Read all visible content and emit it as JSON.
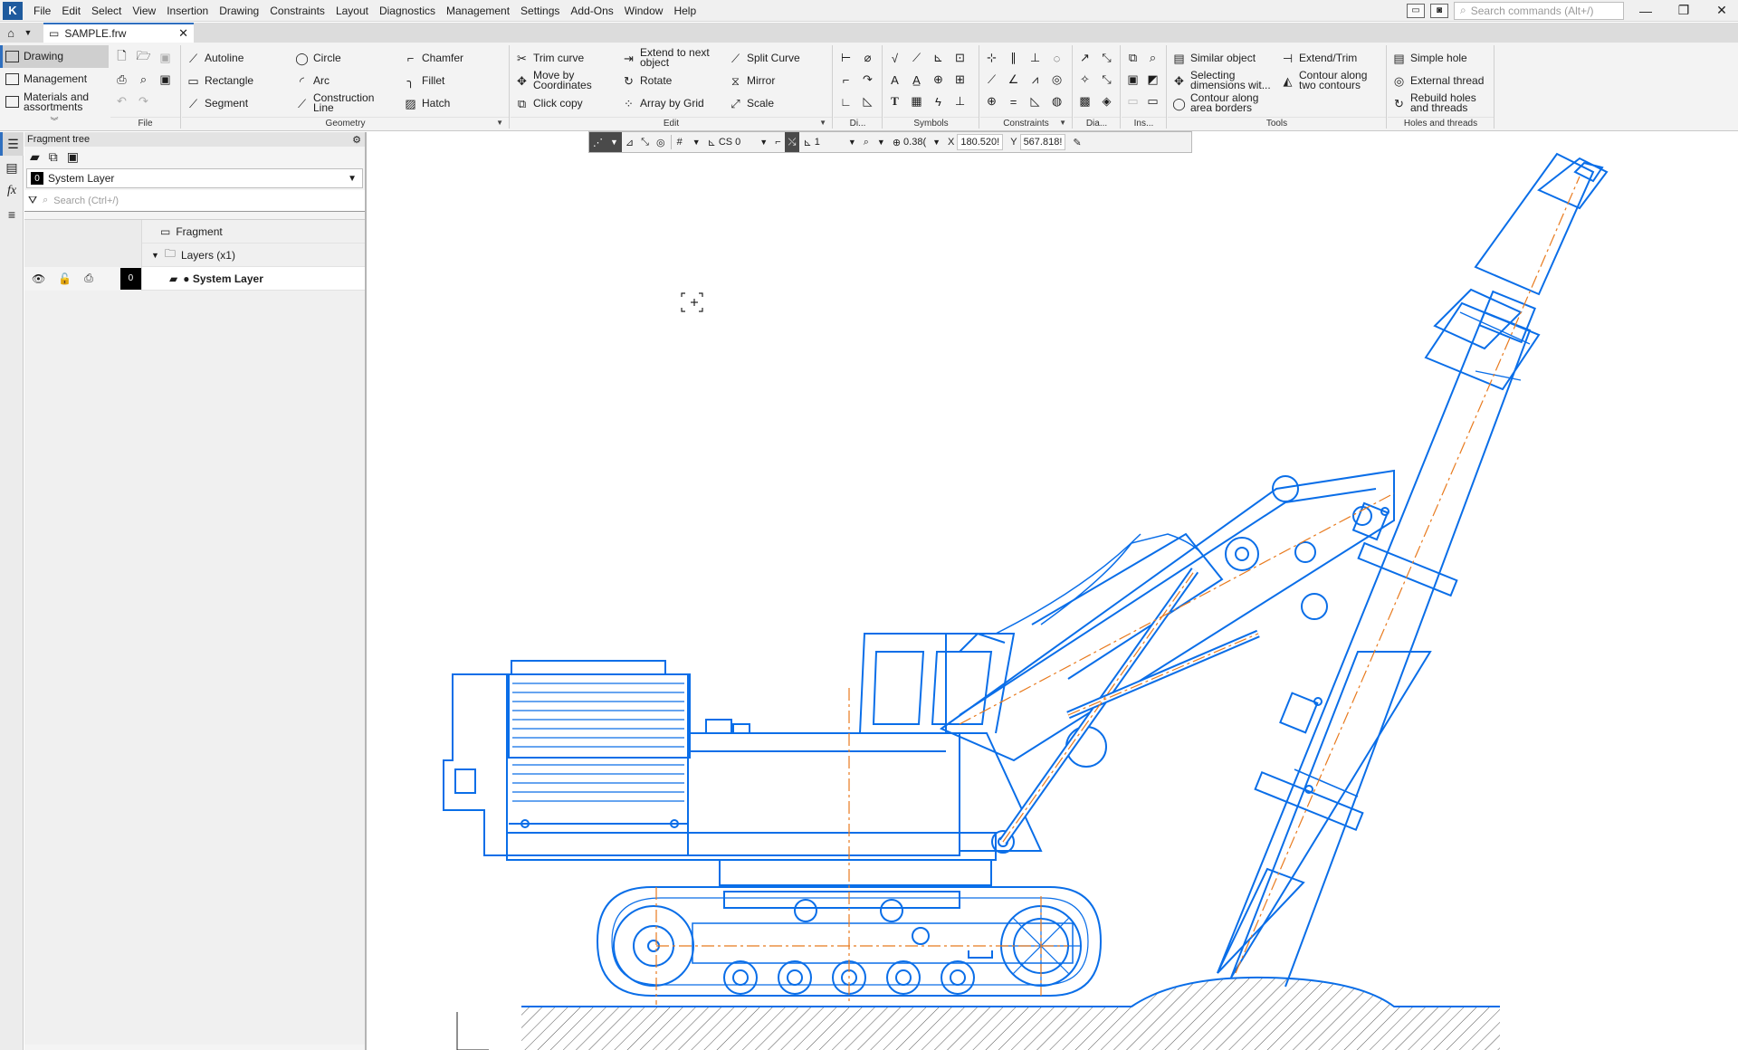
{
  "menu": [
    "File",
    "Edit",
    "Select",
    "View",
    "Insertion",
    "Drawing",
    "Constraints",
    "Layout",
    "Diagnostics",
    "Management",
    "Settings",
    "Add-Ons",
    "Window",
    "Help"
  ],
  "command_search": {
    "placeholder": "Search commands (Alt+/)"
  },
  "tab": {
    "title": "SAMPLE.frw"
  },
  "ribbon_left": [
    {
      "label": "Drawing",
      "active": true
    },
    {
      "label": "Management"
    },
    {
      "label": "Materials and assortments"
    }
  ],
  "groups": {
    "file": "File",
    "geometry": "Geometry",
    "edit": "Edit",
    "di": "Di...",
    "symbols": "Symbols",
    "constraints": "Constraints",
    "dia": "Dia...",
    "ins": "Ins...",
    "tools": "Tools",
    "holes": "Holes and threads"
  },
  "geometry_buttons": [
    "Autoline",
    "Rectangle",
    "Segment",
    "Circle",
    "Arc",
    "Construction Line",
    "Chamfer",
    "Fillet",
    "Hatch"
  ],
  "edit_buttons": [
    "Trim curve",
    "Move by Coordinates",
    "Click copy",
    "Extend to next object",
    "Rotate",
    "Array by Grid",
    "Split Curve",
    "Mirror",
    "Scale"
  ],
  "tools_buttons": [
    "Similar object",
    "Selecting dimensions wit...",
    "Contour along area borders",
    "Extend/Trim",
    "Contour along two contours"
  ],
  "holes_buttons": [
    "Simple hole",
    "External thread",
    "Rebuild holes and threads"
  ],
  "panel": {
    "title": "Fragment tree",
    "layer_number": "0",
    "layer_name": "System Layer",
    "search_placeholder": "Search (Ctrl+/)",
    "tree_fragment": "Fragment",
    "tree_layers": "Layers (x1)",
    "tree_layer_item": "● System Layer",
    "tree_layer_num": "0"
  },
  "canvas_toolbar": {
    "cs": "CS 0",
    "step": "1",
    "zoom": "0.38(",
    "x_label": "X",
    "x_value": "180.520!",
    "y_label": "Y",
    "y_value": "567.818!"
  },
  "colors": {
    "drawing_blue": "#0a6ee8",
    "axis_orange": "#e87a1e",
    "accent": "#2f6fbf"
  }
}
